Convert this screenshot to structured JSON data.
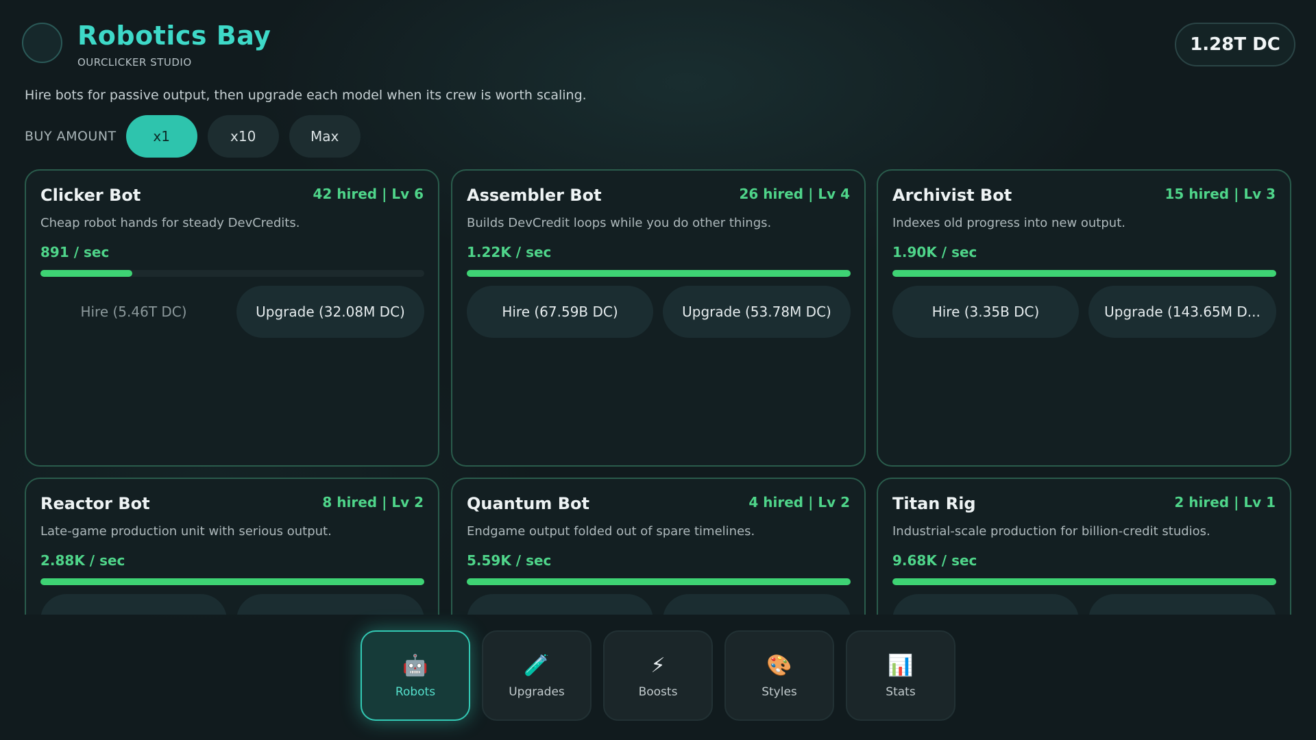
{
  "header": {
    "title": "Robotics Bay",
    "studio": "OURCLICKER STUDIO",
    "balance": "1.28T DC"
  },
  "intro": "Hire bots for passive output, then upgrade each model when its crew is worth scaling.",
  "buy_amount": {
    "label": "BUY AMOUNT",
    "options": [
      "x1",
      "x10",
      "Max"
    ],
    "selected": "x1"
  },
  "bots": [
    {
      "name": "Clicker Bot",
      "meta": "42 hired | Lv 6",
      "desc": "Cheap robot hands for steady DevCredits.",
      "rate": "891 / sec",
      "progress": 0.24,
      "hire": "Hire (5.46T DC)",
      "upgrade": "Upgrade (32.08M DC)",
      "hire_disabled": true
    },
    {
      "name": "Assembler Bot",
      "meta": "26 hired | Lv 4",
      "desc": "Builds DevCredit loops while you do other things.",
      "rate": "1.22K / sec",
      "progress": 1.0,
      "hire": "Hire (67.59B DC)",
      "upgrade": "Upgrade (53.78M DC)",
      "hire_disabled": false
    },
    {
      "name": "Archivist Bot",
      "meta": "15 hired | Lv 3",
      "desc": "Indexes old progress into new output.",
      "rate": "1.90K / sec",
      "progress": 1.0,
      "hire": "Hire (3.35B DC)",
      "upgrade": "Upgrade (143.65M D...",
      "hire_disabled": false
    },
    {
      "name": "Reactor Bot",
      "meta": "8 hired | Lv 2",
      "desc": "Late-game production unit with serious output.",
      "rate": "2.88K / sec",
      "progress": 1.0,
      "hire": "",
      "upgrade": "",
      "hire_disabled": false
    },
    {
      "name": "Quantum Bot",
      "meta": "4 hired | Lv 2",
      "desc": "Endgame output folded out of spare timelines.",
      "rate": "5.59K / sec",
      "progress": 1.0,
      "hire": "",
      "upgrade": "",
      "hire_disabled": false
    },
    {
      "name": "Titan Rig",
      "meta": "2 hired | Lv 1",
      "desc": "Industrial-scale production for billion-credit studios.",
      "rate": "9.68K / sec",
      "progress": 1.0,
      "hire": "",
      "upgrade": "",
      "hire_disabled": false
    }
  ],
  "nav": [
    {
      "label": "Robots",
      "icon": "robot-icon",
      "glyph": "🤖",
      "active": true
    },
    {
      "label": "Upgrades",
      "icon": "test-tube-icon",
      "glyph": "🧪",
      "active": false
    },
    {
      "label": "Boosts",
      "icon": "lightning-icon",
      "glyph": "⚡",
      "active": false
    },
    {
      "label": "Styles",
      "icon": "palette-icon",
      "glyph": "🎨",
      "active": false
    },
    {
      "label": "Stats",
      "icon": "bar-chart-icon",
      "glyph": "📊",
      "active": false
    }
  ],
  "colors": {
    "accent": "#2ec4ad",
    "rate_green": "#4fd58a",
    "progress_green": "#3ed374",
    "card_border": "#2a5c4c"
  }
}
